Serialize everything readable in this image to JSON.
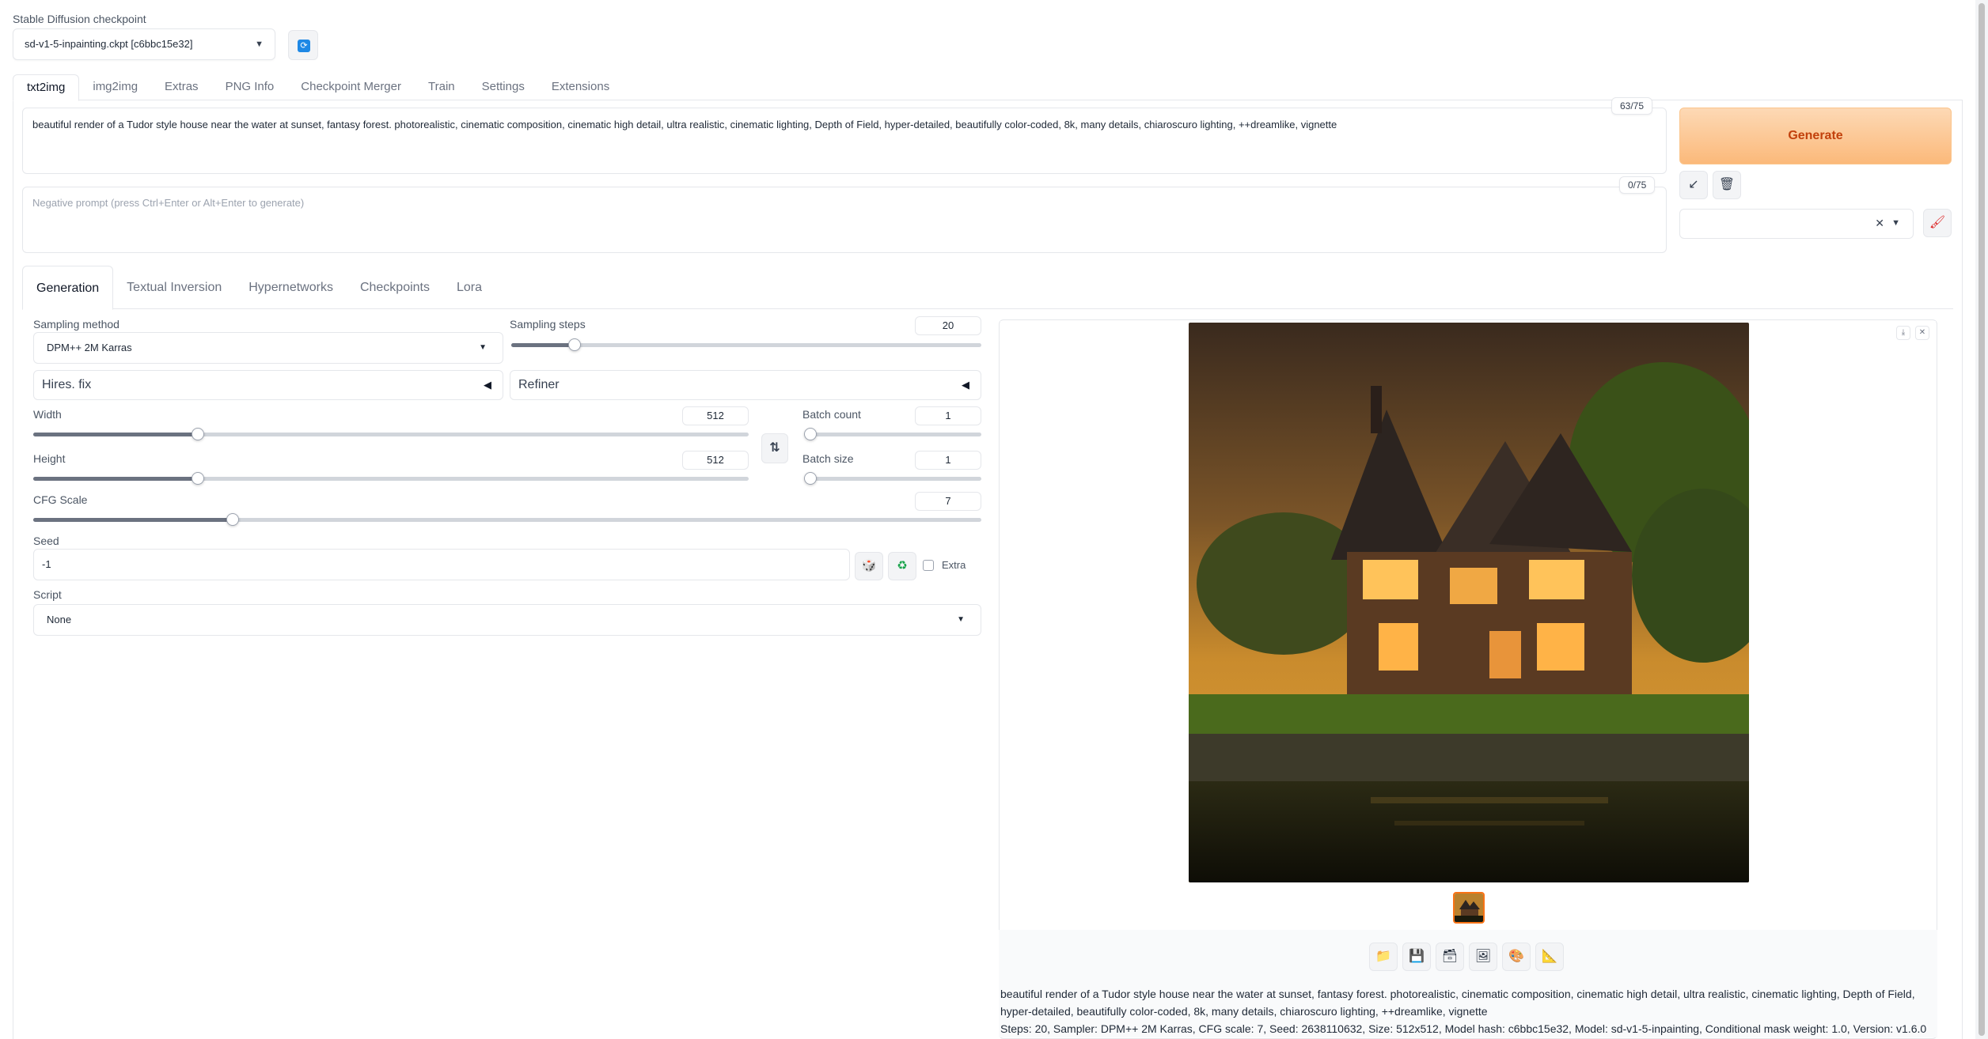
{
  "checkpoint": {
    "label": "Stable Diffusion checkpoint",
    "value": "sd-v1-5-inpainting.ckpt [c6bbc15e32]"
  },
  "main_tabs": [
    "txt2img",
    "img2img",
    "Extras",
    "PNG Info",
    "Checkpoint Merger",
    "Train",
    "Settings",
    "Extensions"
  ],
  "prompt": {
    "text": "beautiful render of a Tudor style house near the water at sunset, fantasy forest. photorealistic, cinematic composition, cinematic high detail, ultra realistic, cinematic lighting, Depth of Field, hyper-detailed, beautifully color-coded, 8k, many details, chiaroscuro lighting, ++dreamlike, vignette",
    "token_count": "63/75"
  },
  "negative_prompt": {
    "placeholder": "Negative prompt (press Ctrl+Enter or Alt+Enter to generate)",
    "token_count": "0/75"
  },
  "generate_label": "Generate",
  "sub_tabs": [
    "Generation",
    "Textual Inversion",
    "Hypernetworks",
    "Checkpoints",
    "Lora"
  ],
  "sampling": {
    "method_label": "Sampling method",
    "method_value": "DPM++ 2M Karras",
    "steps_label": "Sampling steps",
    "steps_value": "20",
    "steps_fraction": 0.135
  },
  "accordions": {
    "hires": "Hires. fix",
    "refiner": "Refiner"
  },
  "width": {
    "label": "Width",
    "value": "512",
    "fraction": 0.23
  },
  "height": {
    "label": "Height",
    "value": "512",
    "fraction": 0.23
  },
  "batch_count": {
    "label": "Batch count",
    "value": "1",
    "fraction": 0.0
  },
  "batch_size": {
    "label": "Batch size",
    "value": "1",
    "fraction": 0.0
  },
  "cfg": {
    "label": "CFG Scale",
    "value": "7",
    "fraction": 0.21
  },
  "seed": {
    "label": "Seed",
    "value": "-1",
    "extra_label": "Extra"
  },
  "script": {
    "label": "Script",
    "value": "None"
  },
  "output": {
    "info_prompt": "beautiful render of a Tudor style house near the water at sunset, fantasy forest. photorealistic, cinematic composition, cinematic high detail, ultra realistic, cinematic lighting, Depth of Field, hyper-detailed, beautifully color-coded, 8k, many details, chiaroscuro lighting, ++dreamlike, vignette",
    "info_params": "Steps: 20, Sampler: DPM++ 2M Karras, CFG scale: 7, Seed: 2638110632, Size: 512x512, Model hash: c6bbc15e32, Model: sd-v1-5-inpainting, Conditional mask weight: 1.0, Version: v1.6.0"
  },
  "icons": {
    "refresh": "refresh-icon",
    "swap": "swap-icon",
    "dice": "dice-icon",
    "recycle": "recycle-icon",
    "folder": "folder-icon",
    "save": "save-icon",
    "zip": "zip-icon",
    "image": "image-icon",
    "palette": "palette-icon",
    "ruler": "ruler-icon"
  },
  "colors": {
    "accent": "#f97316",
    "generate_text": "#c2410c"
  }
}
